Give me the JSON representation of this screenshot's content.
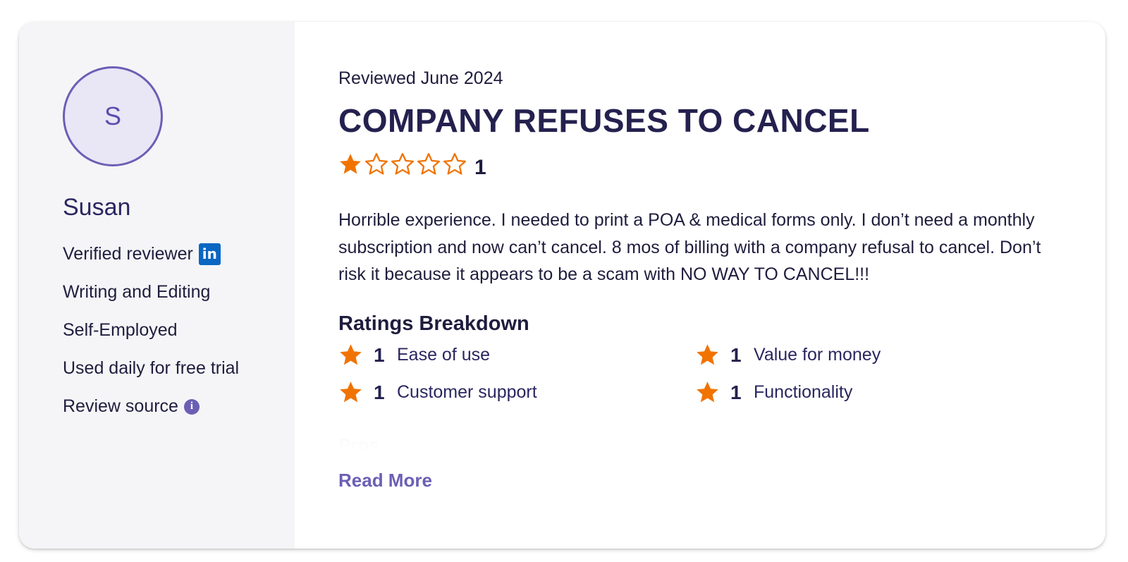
{
  "reviewer": {
    "initial": "S",
    "name": "Susan",
    "verified_label": "Verified reviewer",
    "verified_icon": "linkedin-icon",
    "industry": "Writing and Editing",
    "company_size": "Self-Employed",
    "usage": "Used daily for free trial",
    "source_label": "Review source",
    "source_icon": "info-icon"
  },
  "review": {
    "date": "Reviewed June 2024",
    "title": "COMPANY REFUSES TO CANCEL",
    "overall_rating": 1,
    "overall_rating_label": "1",
    "max_rating": 5,
    "body": "Horrible experience. I needed to print a POA & medical forms only. I don’t need a monthly subscription and now can’t cancel. 8 mos of billing with a company refusal to cancel. Don’t risk it because it appears to be a scam with NO WAY TO CANCEL!!!",
    "faded_next_heading": "Pros",
    "read_more": "Read More"
  },
  "breakdown": {
    "title": "Ratings Breakdown",
    "items": [
      {
        "score": "1",
        "label": "Ease of use"
      },
      {
        "score": "1",
        "label": "Value for money"
      },
      {
        "score": "1",
        "label": "Customer support"
      },
      {
        "score": "1",
        "label": "Functionality"
      }
    ]
  },
  "colors": {
    "star_fill": "#f07300",
    "accent": "#6b5fb5",
    "title": "#24214f",
    "sidebar_bg": "#f5f5f7",
    "linkedin": "#0a66c2"
  }
}
